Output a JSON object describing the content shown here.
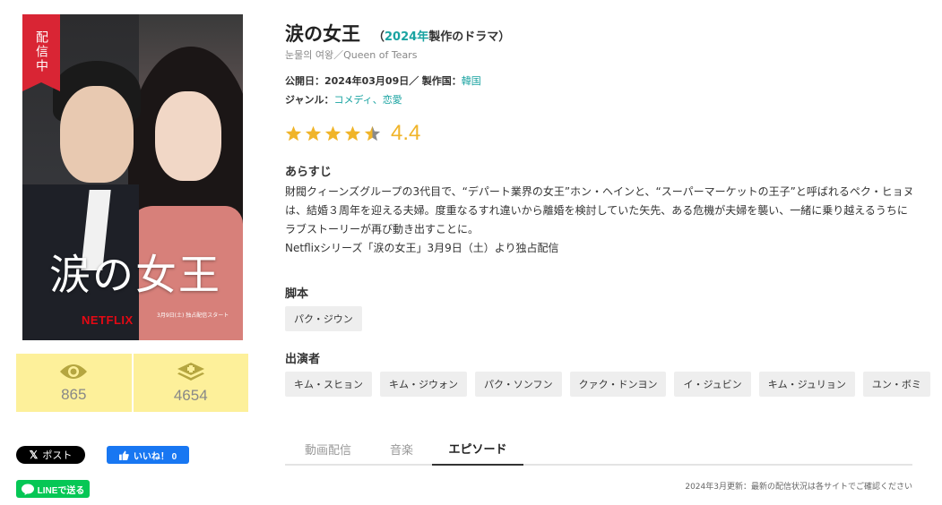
{
  "poster": {
    "badge": "配信中",
    "title_art": "涙の女王",
    "brand": "NETFLIX",
    "date_note": "3月9日(土) 独占配信スタート"
  },
  "stats": {
    "views": "865",
    "saves": "4654"
  },
  "share": {
    "x_label": "ポスト",
    "like_label": "いいね！ 0",
    "line_label": "LINEで送る"
  },
  "header": {
    "title": "涙の女王",
    "meta_open": "（",
    "year": "2024年",
    "meta_suffix": "製作のドラマ）",
    "subtitle": "눈물의 여왕／Queen of Tears"
  },
  "info": {
    "release_label": "公開日：",
    "release_value": "2024年03月09日／",
    "country_label": "製作国：",
    "country_value": "韓国",
    "genre_label": "ジャンル：",
    "genre_1": "コメディ",
    "genre_sep": "、",
    "genre_2": "恋愛"
  },
  "rating": {
    "score": "4.4",
    "value": 4.4,
    "max": 5
  },
  "synopsis": {
    "heading": "あらすじ",
    "body": "財閥クィーンズグループの3代目で、“デパート業界の女王”ホン・ヘインと、“スーパーマーケットの王子”と呼ばれるペク・ヒョヌは、結婚３周年を迎える夫婦。度重なるすれ違いから離婚を検討していた矢先、ある危機が夫婦を襲い、一緒に乗り越えるうちにラブストーリーが再び動き出すことに。",
    "body2": "Netflixシリーズ「涙の女王」3月9日（土）より独占配信"
  },
  "writer": {
    "heading": "脚本",
    "names": [
      "パク・ジウン"
    ]
  },
  "cast": {
    "heading": "出演者",
    "names": [
      "キム・スヒョン",
      "キム・ジウォン",
      "パク・ソンフン",
      "クァク・ドンヨン",
      "イ・ジュビン",
      "キム・ジュリョン",
      "ユン・ボミ"
    ]
  },
  "tabs": [
    "動画配信",
    "音楽",
    "エピソード"
  ],
  "active_tab": "エピソード",
  "footnote": "2024年3月更新：最新の配信状況は各サイトでご確認ください",
  "colors": {
    "accent": "#19a3a1",
    "star": "#f0b429",
    "stats_bg": "#fdf09a",
    "badge": "#d92534"
  }
}
